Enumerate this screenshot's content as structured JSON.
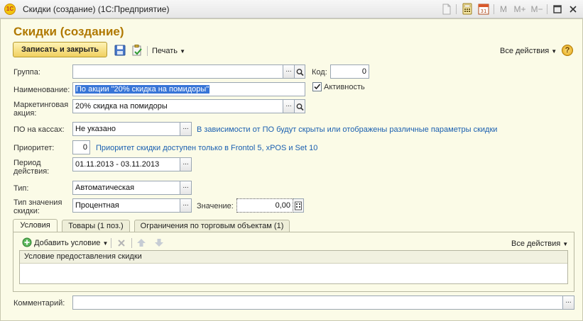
{
  "window": {
    "app_logo": "1С",
    "title": "Скидки (создание)  (1С:Предприятие)",
    "toolbar": [
      "M",
      "M+",
      "M−"
    ]
  },
  "form": {
    "title": "Скидки (создание)",
    "save_close": "Записать и закрыть",
    "print": "Печать",
    "all_actions": "Все действия",
    "help": "?"
  },
  "fields": {
    "group_label": "Группа:",
    "group_value": "",
    "code_label": "Код:",
    "code_value": "0",
    "name_label": "Наименование:",
    "name_value": "По акции \"20% скидка на помидоры\"",
    "active_label": "Активность",
    "promo_label": "Маркетинговая акция:",
    "promo_value": "20% скидка на помидоры",
    "pos_label": "ПО на кассах:",
    "pos_value": "Не указано",
    "pos_hint": "В зависимости от ПО будут скрыты или отображены различные параметры скидки",
    "priority_label": "Приоритет:",
    "priority_value": "0",
    "priority_hint": "Приоритет скидки доступен только в Frontol 5, xPOS и Set 10",
    "period_label": "Период действия:",
    "period_value": "01.11.2013 - 03.11.2013",
    "type_label": "Тип:",
    "type_value": "Автоматическая",
    "value_type_label": "Тип значения скидки:",
    "value_type_value": "Процентная",
    "value_label": "Значение:",
    "value_value": "0,00",
    "comment_label": "Комментарий:",
    "comment_value": ""
  },
  "tabs": [
    {
      "label": "Условия"
    },
    {
      "label": "Товары (1 поз.)"
    },
    {
      "label": "Ограничения по торговым объектам (1)"
    }
  ],
  "tab_panel": {
    "add_condition": "Добавить условие",
    "all_actions": "Все действия",
    "column_header": "Условие предоставления скидки"
  },
  "colors": {
    "title": "#b07800",
    "hint": "#1a5fb0",
    "form_bg": "#fbfbe7",
    "selection": "#3875d7"
  }
}
